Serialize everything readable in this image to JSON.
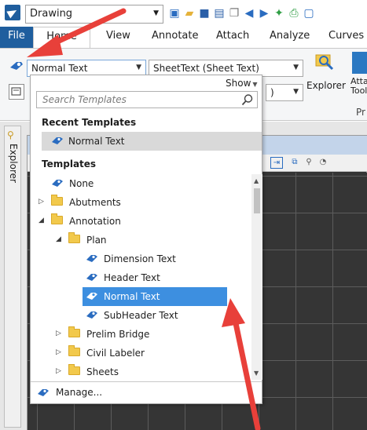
{
  "titlebar": {
    "workflow": "Drawing"
  },
  "ribbon_tabs": [
    "File",
    "Home",
    "View",
    "Annotate",
    "Attach",
    "Analyze",
    "Curves"
  ],
  "ribbon": {
    "template_combo": "Normal Text",
    "sheet_text_combo": "SheetText (Sheet Text)",
    "small_combo": ")",
    "explorer_label": "Explorer",
    "attach_label_1": "Atta",
    "attach_label_2": "Tool",
    "group_label": "Pr"
  },
  "explorer_panel": {
    "label": "Explorer"
  },
  "dropdown": {
    "show_label": "Show",
    "search_placeholder": "Search Templates",
    "recent_header": "Recent Templates",
    "recent_items": [
      "Normal Text"
    ],
    "templates_header": "Templates",
    "tree": [
      {
        "label": "None",
        "type": "template",
        "level": 0,
        "expander": ""
      },
      {
        "label": "Abutments",
        "type": "folder",
        "level": 0,
        "expander": "collapsed"
      },
      {
        "label": "Annotation",
        "type": "folder",
        "level": 0,
        "expander": "expanded"
      },
      {
        "label": "Plan",
        "type": "folder",
        "level": 1,
        "expander": "expanded"
      },
      {
        "label": "Dimension Text",
        "type": "template",
        "level": 2,
        "expander": ""
      },
      {
        "label": "Header Text",
        "type": "template",
        "level": 2,
        "expander": ""
      },
      {
        "label": "Normal Text",
        "type": "template",
        "level": 2,
        "expander": "",
        "selected": true
      },
      {
        "label": "SubHeader Text",
        "type": "template",
        "level": 2,
        "expander": ""
      },
      {
        "label": "Prelim Bridge",
        "type": "folder",
        "level": 1,
        "expander": "collapsed"
      },
      {
        "label": "Civil Labeler",
        "type": "folder",
        "level": 1,
        "expander": "collapsed"
      },
      {
        "label": "Sheets",
        "type": "folder",
        "level": 1,
        "expander": "collapsed"
      }
    ],
    "manage_label": "Manage..."
  },
  "colors": {
    "selection": "#3d8fe0",
    "annotation_arrow": "#e8403a",
    "file_tab": "#1f5e9e"
  }
}
